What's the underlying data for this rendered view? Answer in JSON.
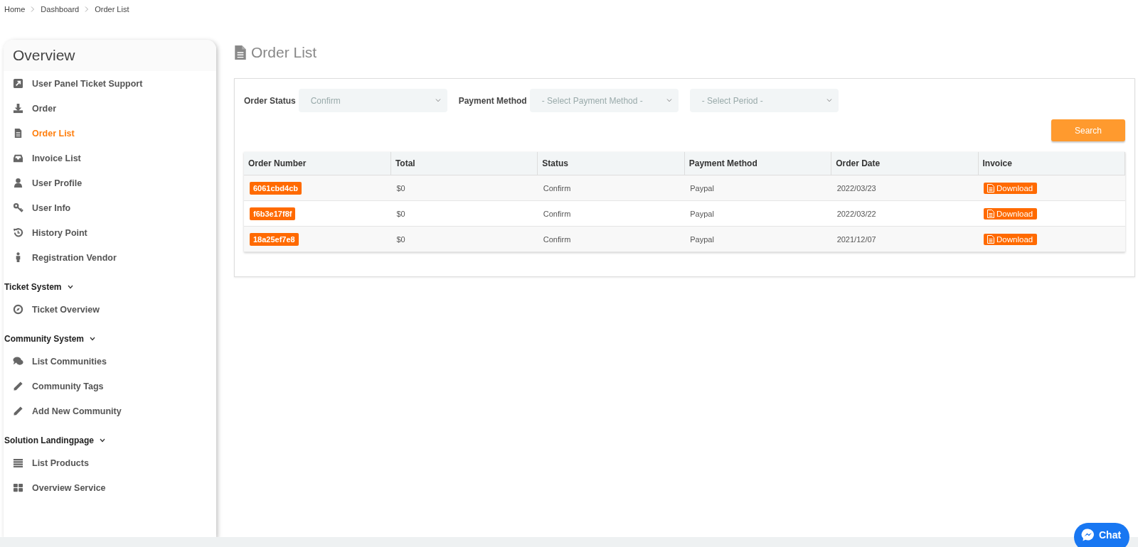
{
  "breadcrumb": [
    "Home",
    "Dashboard",
    "Order List"
  ],
  "sidebar": {
    "title": "Overview",
    "items": [
      {
        "label": "User Panel Ticket Support",
        "selected": false
      },
      {
        "label": "Order",
        "selected": false
      },
      {
        "label": "Order List",
        "selected": true
      },
      {
        "label": "Invoice List",
        "selected": false
      },
      {
        "label": "User Profile",
        "selected": false
      },
      {
        "label": "User Info",
        "selected": false
      },
      {
        "label": "History Point",
        "selected": false
      },
      {
        "label": "Registration Vendor",
        "selected": false
      }
    ],
    "sections": [
      {
        "label": "Ticket System",
        "items": [
          {
            "label": "Ticket Overview",
            "selected": false
          }
        ]
      },
      {
        "label": "Community System",
        "items": [
          {
            "label": "List Communities",
            "selected": false
          },
          {
            "label": "Community Tags",
            "selected": false
          },
          {
            "label": "Add New Community",
            "selected": false
          }
        ]
      },
      {
        "label": "Solution Landingpage",
        "items": [
          {
            "label": "List Products",
            "selected": false
          },
          {
            "label": "Overview Service",
            "selected": false
          }
        ]
      }
    ]
  },
  "page_title": "Order List",
  "filters": [
    {
      "label": "Order Status",
      "value": "Confirm"
    },
    {
      "label": "Payment Method",
      "placeholder": "- Select Payment Method -"
    },
    {
      "placeholder": "- Select Period -"
    }
  ],
  "search_button": "Search",
  "table": {
    "columns": [
      "Order Number",
      "Total",
      "Status",
      "Payment Method",
      "Order Date",
      "Invoice"
    ],
    "rows": [
      {
        "order_number": "6061cbd4cb",
        "total": "$0",
        "status": "Confirm",
        "payment_method": "Paypal",
        "order_date": "2022/03/23",
        "invoice": "Download"
      },
      {
        "order_number": "f6b3e17f8f",
        "total": "$0",
        "status": "Confirm",
        "payment_method": "Paypal",
        "order_date": "2022/03/22",
        "invoice": "Download"
      },
      {
        "order_number": "18a25ef7e8",
        "total": "$0",
        "status": "Confirm",
        "payment_method": "Paypal",
        "order_date": "2021/12/07",
        "invoice": "Download"
      }
    ]
  },
  "chat_button": "Chat"
}
